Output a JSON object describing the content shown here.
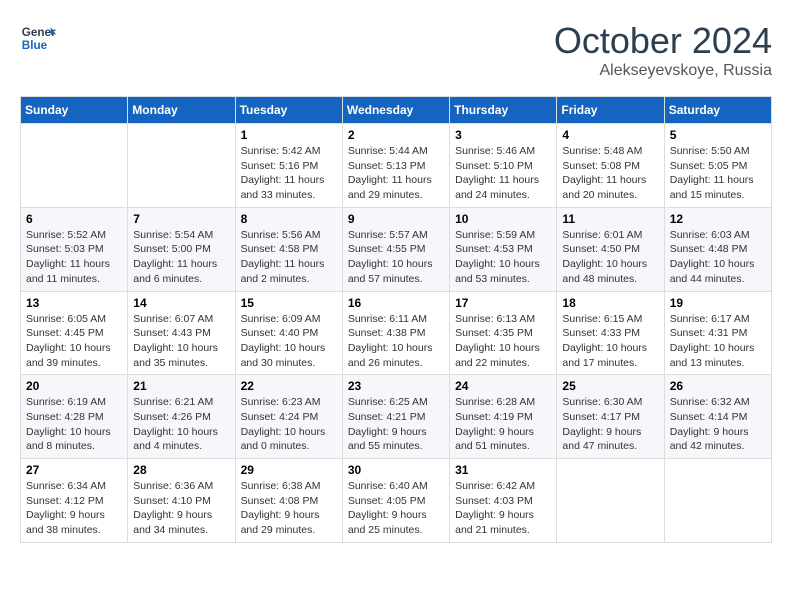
{
  "header": {
    "logo_line1": "General",
    "logo_line2": "Blue",
    "month": "October 2024",
    "location": "Alekseyevskoye, Russia"
  },
  "weekdays": [
    "Sunday",
    "Monday",
    "Tuesday",
    "Wednesday",
    "Thursday",
    "Friday",
    "Saturday"
  ],
  "weeks": [
    [
      {
        "day": "",
        "info": ""
      },
      {
        "day": "",
        "info": ""
      },
      {
        "day": "1",
        "info": "Sunrise: 5:42 AM\nSunset: 5:16 PM\nDaylight: 11 hours and 33 minutes."
      },
      {
        "day": "2",
        "info": "Sunrise: 5:44 AM\nSunset: 5:13 PM\nDaylight: 11 hours and 29 minutes."
      },
      {
        "day": "3",
        "info": "Sunrise: 5:46 AM\nSunset: 5:10 PM\nDaylight: 11 hours and 24 minutes."
      },
      {
        "day": "4",
        "info": "Sunrise: 5:48 AM\nSunset: 5:08 PM\nDaylight: 11 hours and 20 minutes."
      },
      {
        "day": "5",
        "info": "Sunrise: 5:50 AM\nSunset: 5:05 PM\nDaylight: 11 hours and 15 minutes."
      }
    ],
    [
      {
        "day": "6",
        "info": "Sunrise: 5:52 AM\nSunset: 5:03 PM\nDaylight: 11 hours and 11 minutes."
      },
      {
        "day": "7",
        "info": "Sunrise: 5:54 AM\nSunset: 5:00 PM\nDaylight: 11 hours and 6 minutes."
      },
      {
        "day": "8",
        "info": "Sunrise: 5:56 AM\nSunset: 4:58 PM\nDaylight: 11 hours and 2 minutes."
      },
      {
        "day": "9",
        "info": "Sunrise: 5:57 AM\nSunset: 4:55 PM\nDaylight: 10 hours and 57 minutes."
      },
      {
        "day": "10",
        "info": "Sunrise: 5:59 AM\nSunset: 4:53 PM\nDaylight: 10 hours and 53 minutes."
      },
      {
        "day": "11",
        "info": "Sunrise: 6:01 AM\nSunset: 4:50 PM\nDaylight: 10 hours and 48 minutes."
      },
      {
        "day": "12",
        "info": "Sunrise: 6:03 AM\nSunset: 4:48 PM\nDaylight: 10 hours and 44 minutes."
      }
    ],
    [
      {
        "day": "13",
        "info": "Sunrise: 6:05 AM\nSunset: 4:45 PM\nDaylight: 10 hours and 39 minutes."
      },
      {
        "day": "14",
        "info": "Sunrise: 6:07 AM\nSunset: 4:43 PM\nDaylight: 10 hours and 35 minutes."
      },
      {
        "day": "15",
        "info": "Sunrise: 6:09 AM\nSunset: 4:40 PM\nDaylight: 10 hours and 30 minutes."
      },
      {
        "day": "16",
        "info": "Sunrise: 6:11 AM\nSunset: 4:38 PM\nDaylight: 10 hours and 26 minutes."
      },
      {
        "day": "17",
        "info": "Sunrise: 6:13 AM\nSunset: 4:35 PM\nDaylight: 10 hours and 22 minutes."
      },
      {
        "day": "18",
        "info": "Sunrise: 6:15 AM\nSunset: 4:33 PM\nDaylight: 10 hours and 17 minutes."
      },
      {
        "day": "19",
        "info": "Sunrise: 6:17 AM\nSunset: 4:31 PM\nDaylight: 10 hours and 13 minutes."
      }
    ],
    [
      {
        "day": "20",
        "info": "Sunrise: 6:19 AM\nSunset: 4:28 PM\nDaylight: 10 hours and 8 minutes."
      },
      {
        "day": "21",
        "info": "Sunrise: 6:21 AM\nSunset: 4:26 PM\nDaylight: 10 hours and 4 minutes."
      },
      {
        "day": "22",
        "info": "Sunrise: 6:23 AM\nSunset: 4:24 PM\nDaylight: 10 hours and 0 minutes."
      },
      {
        "day": "23",
        "info": "Sunrise: 6:25 AM\nSunset: 4:21 PM\nDaylight: 9 hours and 55 minutes."
      },
      {
        "day": "24",
        "info": "Sunrise: 6:28 AM\nSunset: 4:19 PM\nDaylight: 9 hours and 51 minutes."
      },
      {
        "day": "25",
        "info": "Sunrise: 6:30 AM\nSunset: 4:17 PM\nDaylight: 9 hours and 47 minutes."
      },
      {
        "day": "26",
        "info": "Sunrise: 6:32 AM\nSunset: 4:14 PM\nDaylight: 9 hours and 42 minutes."
      }
    ],
    [
      {
        "day": "27",
        "info": "Sunrise: 6:34 AM\nSunset: 4:12 PM\nDaylight: 9 hours and 38 minutes."
      },
      {
        "day": "28",
        "info": "Sunrise: 6:36 AM\nSunset: 4:10 PM\nDaylight: 9 hours and 34 minutes."
      },
      {
        "day": "29",
        "info": "Sunrise: 6:38 AM\nSunset: 4:08 PM\nDaylight: 9 hours and 29 minutes."
      },
      {
        "day": "30",
        "info": "Sunrise: 6:40 AM\nSunset: 4:05 PM\nDaylight: 9 hours and 25 minutes."
      },
      {
        "day": "31",
        "info": "Sunrise: 6:42 AM\nSunset: 4:03 PM\nDaylight: 9 hours and 21 minutes."
      },
      {
        "day": "",
        "info": ""
      },
      {
        "day": "",
        "info": ""
      }
    ]
  ]
}
